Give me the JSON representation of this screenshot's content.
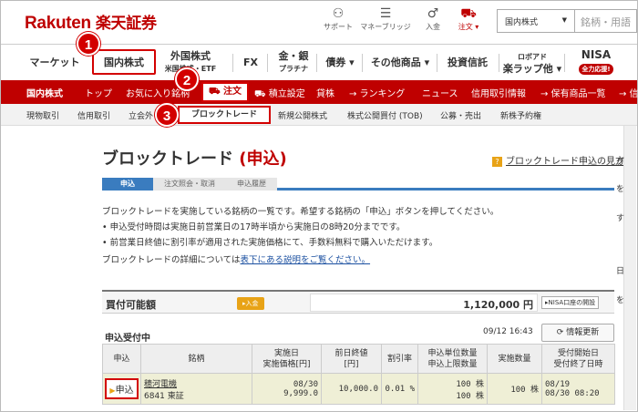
{
  "header": {
    "logo_en": "Rakuten",
    "logo_jp": "楽天証券",
    "icons": [
      {
        "name": "support-icon",
        "glyph": "⚇",
        "label": "サポート"
      },
      {
        "name": "money-bridge-icon",
        "glyph": "☰",
        "label": "マネーブリッジ"
      },
      {
        "name": "deposit-icon",
        "glyph": "♂",
        "label": "入金"
      },
      {
        "name": "cart-icon",
        "glyph": "⛟",
        "label": "注文 ▾"
      }
    ],
    "market_select": "国内株式",
    "search_placeholder": "銘柄・用語"
  },
  "main_nav": {
    "market": "マーケット",
    "domestic": "国内株式",
    "foreign_1": "外国株式",
    "foreign_2": "米国株式・ETF",
    "fx": "FX",
    "metal_1": "金・銀",
    "metal_2": "プラチナ",
    "bond": "債券 ▾",
    "other": "その他商品 ▾",
    "fund": "投資信託",
    "robo_1": "ロボアド",
    "robo_2": "楽ラップ他 ▾",
    "nisa": "NISA",
    "nisa_badge": "全力応援!"
  },
  "badges": [
    "1",
    "2",
    "3"
  ],
  "red_nav": {
    "section": "国内株式",
    "items": [
      "トップ",
      "お気に入り銘柄",
      "注文",
      "積立設定",
      "貸株",
      "→ ランキング",
      "ニュース",
      "信用取引情報",
      "→ 保有商品一覧",
      "→ 信"
    ]
  },
  "grey_nav": {
    "items": [
      "現物取引",
      "信用取引",
      "立会外",
      "ブロックトレード",
      "新規公開株式",
      "株式公開買付 (TOB)",
      "公募・売出",
      "新株予約権"
    ]
  },
  "page": {
    "title": "ブロックトレード",
    "subtitle": "(申込)",
    "help": "ブロックトレード申込の見方",
    "tabs": [
      "申込",
      "注文照会・取消",
      "申込履歴"
    ],
    "desc_1": "ブロックトレードを実施している銘柄の一覧です。希望する銘柄の「申込」ボタンを押してください。",
    "desc_2": "• 申込受付時間は実施日前営業日の17時半頃から実施日の8時20分までです。",
    "desc_3": "• 前営業日終値に割引率が適用された実施価格にて、手数料無料で購入いただけます。",
    "desc_4_pre": "ブロックトレードの詳細については",
    "desc_4_link": "表下にある説明をご覧ください。"
  },
  "available": {
    "label": "買付可能額",
    "deposit": "▸入金",
    "amount": "1,120,000 円",
    "nisa_btn": "▸NISA口座の開設"
  },
  "list": {
    "section": "申込受付中",
    "timestamp": "09/12 16:43",
    "refresh": "⟳ 情報更新",
    "headers": [
      "申込",
      "銘柄",
      "実施日\n実施価格[円]",
      "前日終値\n[円]",
      "割引率",
      "申込単位数量\n申込上限数量",
      "実施数量",
      "受付開始日\n受付終了日時"
    ],
    "row": {
      "apply": "申込",
      "stock_name": "穂河電機",
      "stock_code": "6841 東証",
      "date": "08/30",
      "price": "9,999.0",
      "prev_close": "10,000.0",
      "discount": "0.01 %",
      "unit": "100 株",
      "limit": "100 株",
      "qty": "100 株",
      "start": "08/19",
      "end": "08/30 08:20"
    }
  },
  "side_fragments": [
    "グ",
    "を",
    "す",
    "日",
    "を"
  ]
}
